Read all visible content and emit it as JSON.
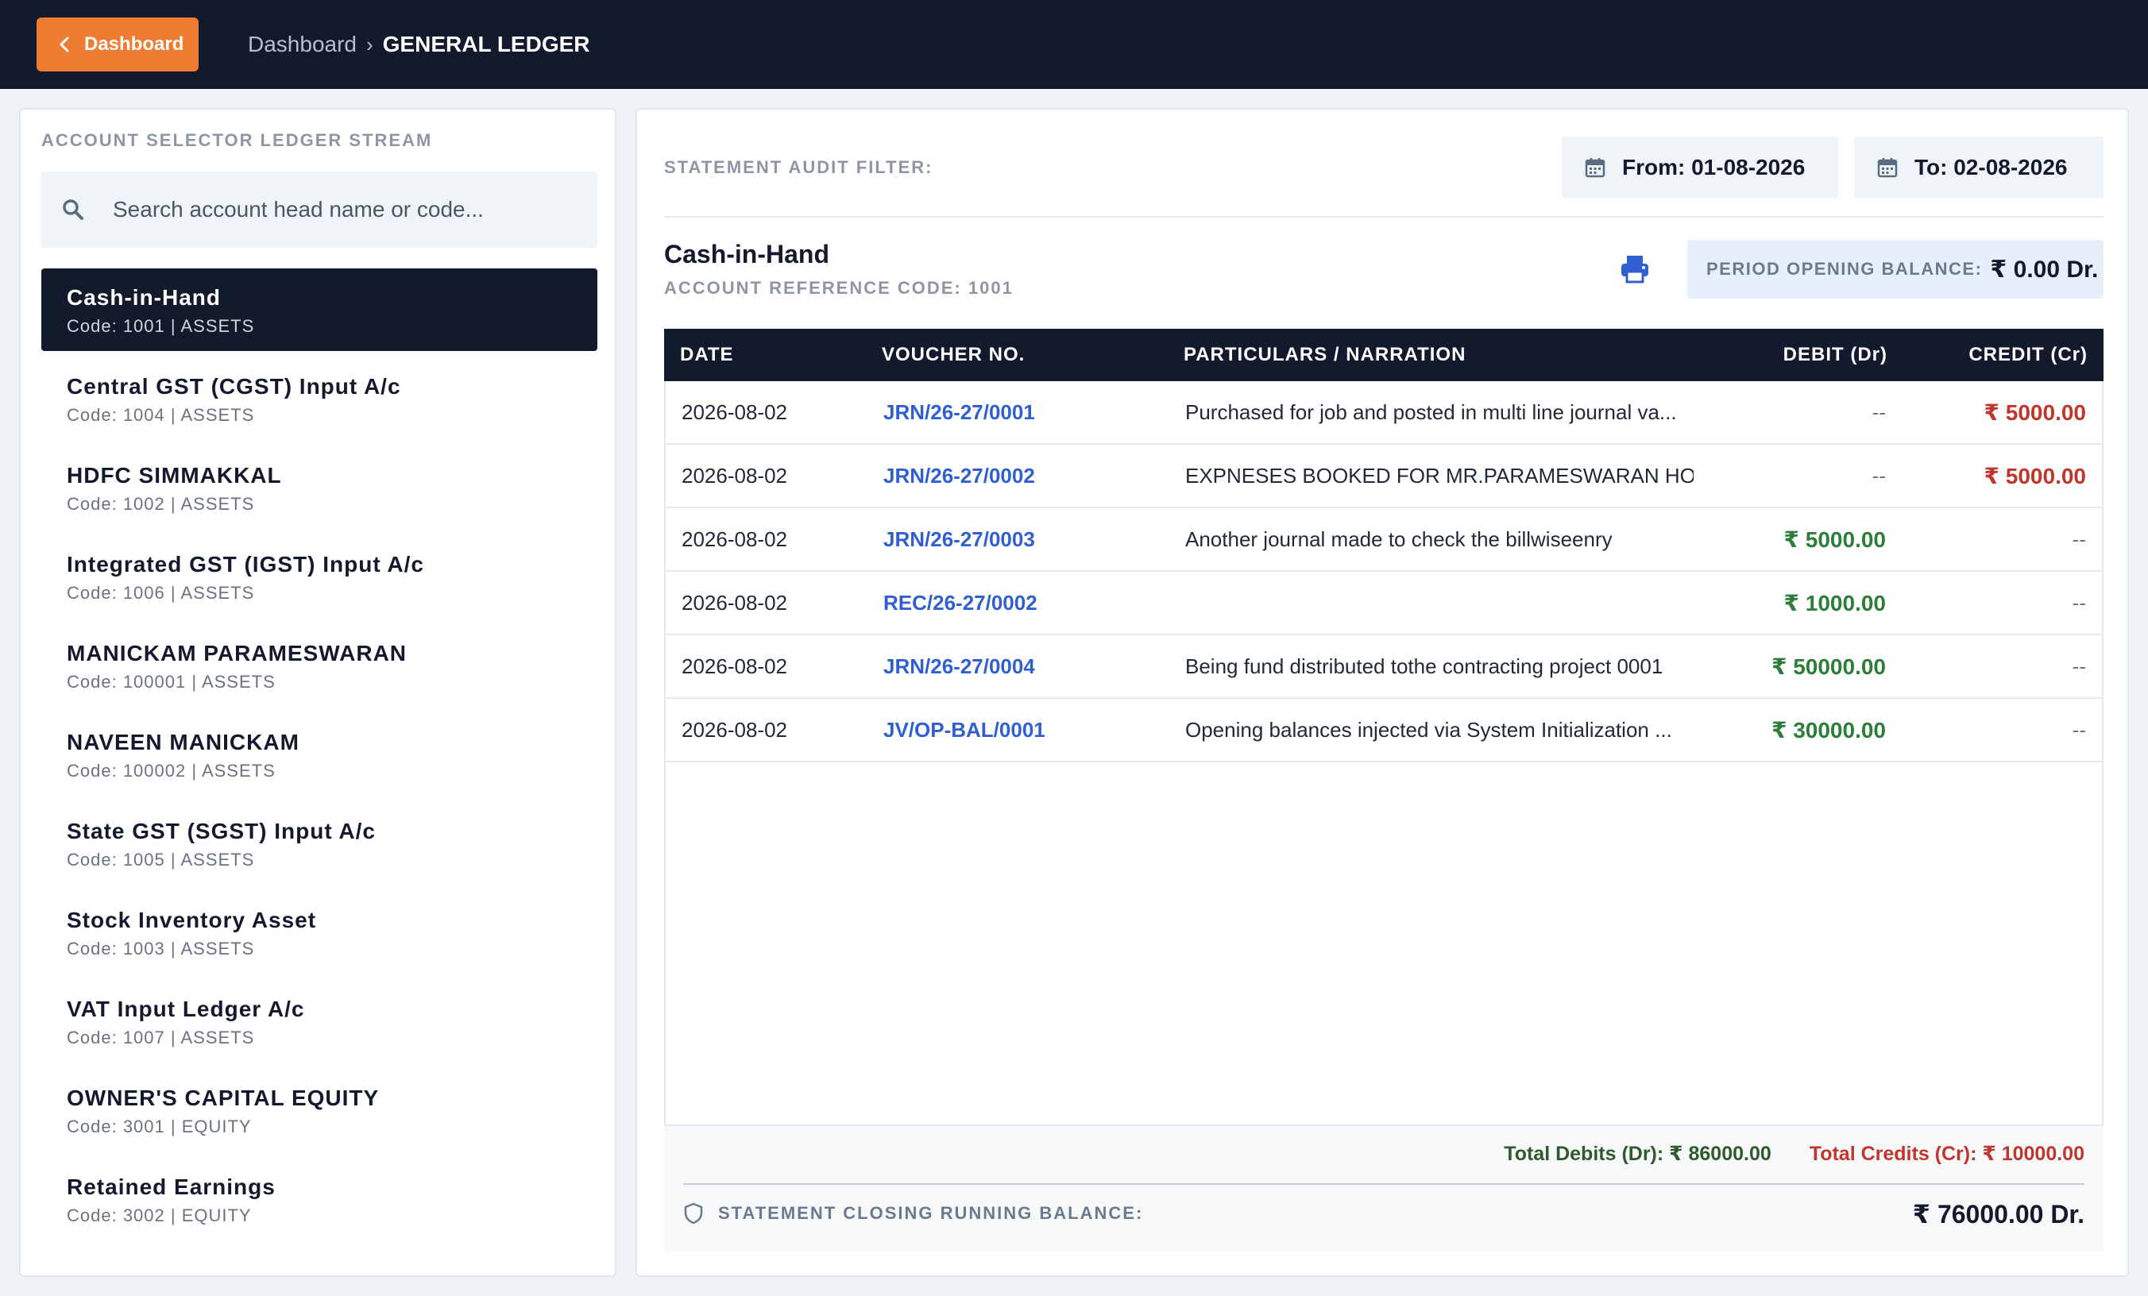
{
  "header": {
    "back_label": "Dashboard",
    "breadcrumb_root": "Dashboard",
    "breadcrumb_sep": "›",
    "breadcrumb_current": "GENERAL LEDGER"
  },
  "sidebar": {
    "title": "ACCOUNT SELECTOR LEDGER STREAM",
    "search_placeholder": "Search account head name or code...",
    "accounts": [
      {
        "name": "Cash-in-Hand",
        "code": "Code: 1001 | ASSETS"
      },
      {
        "name": "Central GST (CGST) Input A/c",
        "code": "Code: 1004 | ASSETS"
      },
      {
        "name": "HDFC SIMMAKKAL",
        "code": "Code: 1002 | ASSETS"
      },
      {
        "name": "Integrated GST (IGST) Input A/c",
        "code": "Code: 1006 | ASSETS"
      },
      {
        "name": "MANICKAM PARAMESWARAN",
        "code": "Code: 100001 | ASSETS"
      },
      {
        "name": "NAVEEN MANICKAM",
        "code": "Code: 100002 | ASSETS"
      },
      {
        "name": "State GST (SGST) Input A/c",
        "code": "Code: 1005 | ASSETS"
      },
      {
        "name": "Stock Inventory Asset",
        "code": "Code: 1003 | ASSETS"
      },
      {
        "name": "VAT Input Ledger A/c",
        "code": "Code: 1007 | ASSETS"
      },
      {
        "name": "OWNER'S CAPITAL EQUITY",
        "code": "Code: 3001 | EQUITY"
      },
      {
        "name": "Retained Earnings",
        "code": "Code: 3002 | EQUITY"
      }
    ]
  },
  "main": {
    "filter_label": "STATEMENT AUDIT FILTER:",
    "from_label": "From: 01-08-2026",
    "to_label": "To: 02-08-2026",
    "account_title": "Cash-in-Hand",
    "account_ref": "ACCOUNT REFERENCE CODE: 1001",
    "opening_label": "PERIOD OPENING BALANCE:",
    "opening_value": "₹ 0.00 Dr.",
    "columns": {
      "date": "DATE",
      "voucher": "VOUCHER NO.",
      "particulars": "PARTICULARS / NARRATION",
      "debit": "DEBIT (Dr)",
      "credit": "CREDIT (Cr)"
    },
    "rows": [
      {
        "date": "2026-08-02",
        "voucher": "JRN/26-27/0001",
        "particulars": "Purchased for job and posted in multi line journal va...",
        "debit": "--",
        "credit": "₹ 5000.00"
      },
      {
        "date": "2026-08-02",
        "voucher": "JRN/26-27/0002",
        "particulars": "EXPNESES BOOKED FOR MR.PARAMESWARAN HO...",
        "debit": "--",
        "credit": "₹ 5000.00"
      },
      {
        "date": "2026-08-02",
        "voucher": "JRN/26-27/0003",
        "particulars": "Another journal made to check the billwiseenry",
        "debit": "₹ 5000.00",
        "credit": "--"
      },
      {
        "date": "2026-08-02",
        "voucher": "REC/26-27/0002",
        "particulars": "",
        "debit": "₹ 1000.00",
        "credit": "--"
      },
      {
        "date": "2026-08-02",
        "voucher": "JRN/26-27/0004",
        "particulars": "Being fund distributed tothe contracting project 0001",
        "debit": "₹ 50000.00",
        "credit": "--"
      },
      {
        "date": "2026-08-02",
        "voucher": "JV/OP-BAL/0001",
        "particulars": "Opening balances injected via System Initialization ...",
        "debit": "₹ 30000.00",
        "credit": "--"
      }
    ],
    "total_debits": "Total Debits (Dr): ₹ 86000.00",
    "total_credits": "Total Credits (Cr): ₹ 10000.00",
    "closing_label": "STATEMENT CLOSING RUNNING BALANCE:",
    "closing_value": "₹ 76000.00 Dr."
  },
  "colors": {
    "navy": "#141a2e",
    "accent_orange": "#ee7d32",
    "link_blue": "#2f5fd0",
    "debit_green": "#2e7d3a",
    "credit_red": "#c0362c"
  },
  "icons": {
    "back": "chevron-left-icon",
    "search": "search-icon",
    "calendar": "calendar-icon",
    "print": "printer-icon",
    "shield": "shield-icon"
  }
}
